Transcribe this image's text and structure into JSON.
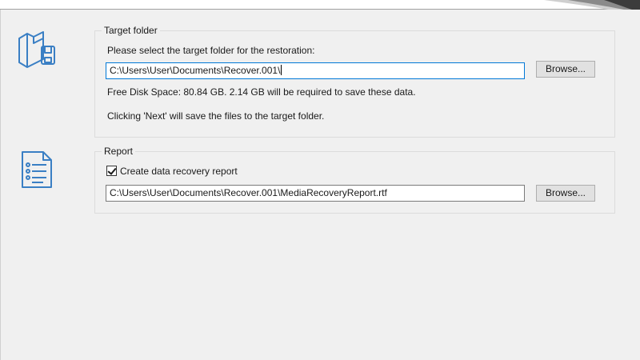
{
  "target": {
    "legend": "Target folder",
    "instruction": "Please select the target folder for the restoration:",
    "path_value": "C:\\Users\\User\\Documents\\Recover.001\\",
    "browse_label": "Browse...",
    "free_space": "Free Disk Space: 80.84 GB. 2.14 GB will be required to save these data.",
    "next_hint": "Clicking 'Next' will save the files to the target folder."
  },
  "report": {
    "legend": "Report",
    "checkbox_label": "Create data recovery report",
    "checkbox_checked": true,
    "path_value": "C:\\Users\\User\\Documents\\Recover.001\\MediaRecoveryReport.rtf",
    "browse_label": "Browse..."
  },
  "icons": {
    "target": "folder-save-icon",
    "report": "report-document-icon"
  },
  "colors": {
    "icon_blue": "#3a7fc4",
    "focus_border": "#0078d7"
  }
}
